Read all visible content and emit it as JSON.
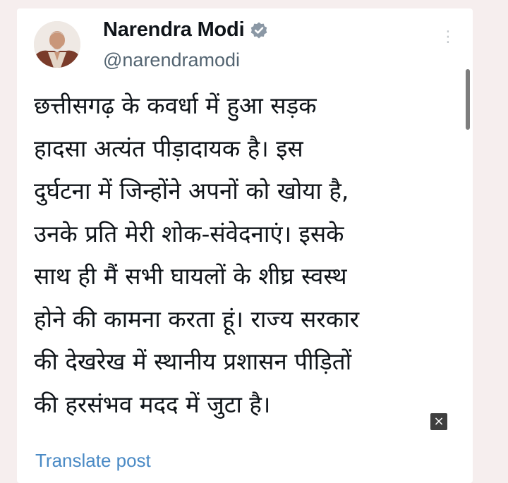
{
  "author": {
    "name": "Narendra Modi",
    "handle": "@narendramodi",
    "verified_icon": "verified-badge-icon",
    "verified_color": "#8b98a5"
  },
  "tweet": {
    "lines": [
      "छत्तीसगढ़ के कवर्धा में हुआ सड़क",
      "हादसा अत्यंत पीड़ादायक है। इस",
      "दुर्घटना में जिन्होंने अपनों को खोया है,",
      "उनके प्रति मेरी शोक-संवेदनाएं। इसके",
      "साथ ही मैं सभी घायलों के शीघ्र स्वस्थ",
      "होने की कामना करता हूं। राज्य सरकार",
      "की देखरेख में स्थानीय प्रशासन पीड़ितों",
      "की हरसंभव मदद में जुटा है।"
    ]
  },
  "actions": {
    "translate_label": "Translate post",
    "more_icon": "more-options-icon",
    "close_icon": "close-icon",
    "close_label": "×"
  },
  "colors": {
    "page_background": "#f6eeee",
    "card_background": "#ffffff",
    "text_primary": "#0f1419",
    "text_secondary": "#536471",
    "link": "#4a8ac5"
  }
}
